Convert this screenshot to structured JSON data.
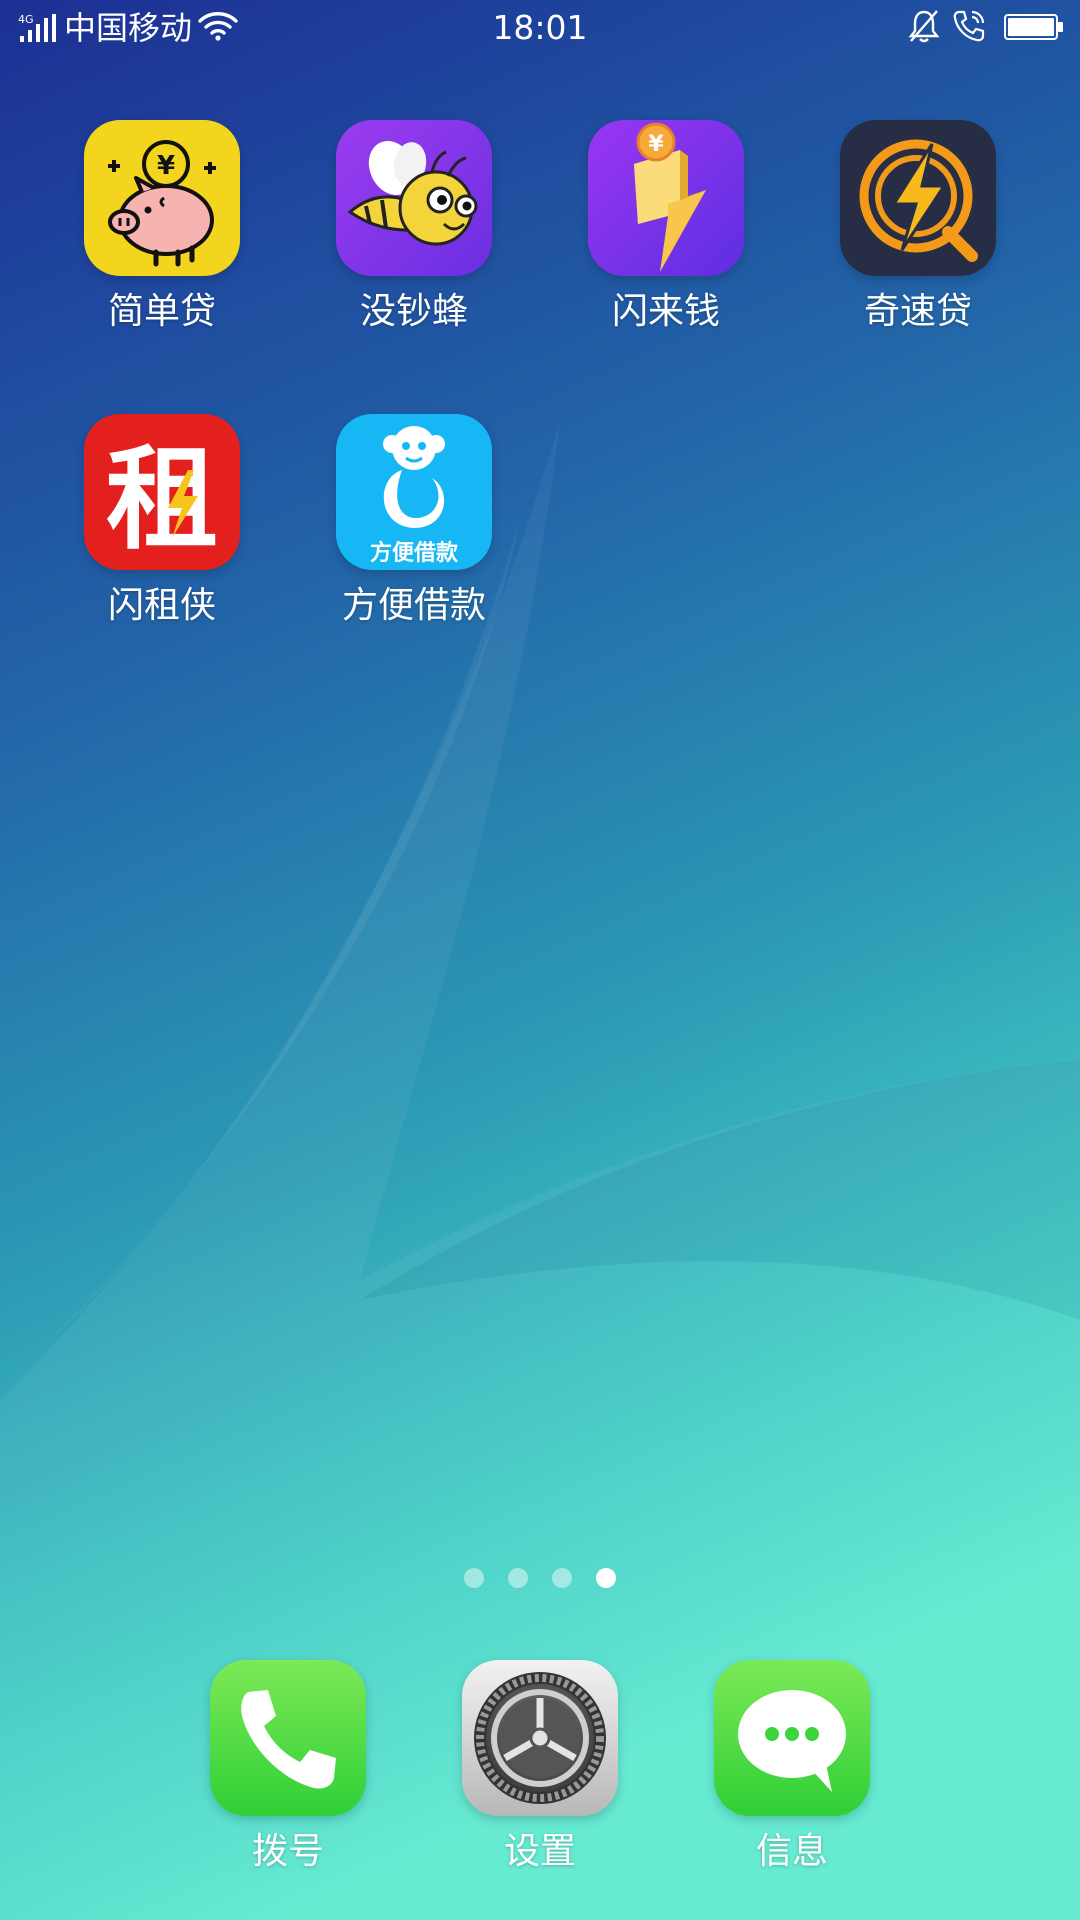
{
  "status_bar": {
    "network": "4G",
    "carrier": "中国移动",
    "time": "18:01"
  },
  "apps": [
    {
      "label": "简单贷",
      "icon": "piggy-bank-icon"
    },
    {
      "label": "没钞蜂",
      "icon": "bee-icon"
    },
    {
      "label": "闪来钱",
      "icon": "lightning-coin-icon"
    },
    {
      "label": "奇速贷",
      "icon": "lightning-circle-icon"
    },
    {
      "label": "闪租侠",
      "icon": "zu-lightning-icon",
      "icon_text": "租"
    },
    {
      "label": "方便借款",
      "icon": "monkey-yuan-icon",
      "icon_text": "方便借款"
    }
  ],
  "page_indicator": {
    "total": 4,
    "current": 4
  },
  "dock": [
    {
      "label": "拨号",
      "icon": "phone-icon"
    },
    {
      "label": "设置",
      "icon": "gear-icon"
    },
    {
      "label": "信息",
      "icon": "message-bubble-icon"
    }
  ],
  "colors": {
    "wallpaper_top": "#1d3395",
    "wallpaper_bottom": "#5ce8cf",
    "piggy_bg": "#f3d51e",
    "bee_bg": "#8a35e6",
    "lightning_bg": "#7d33ea",
    "qisu_bg": "#262d44",
    "zu_bg": "#e3201e",
    "monkey_bg": "#16b7f4",
    "green_bg": "#52de3c"
  }
}
